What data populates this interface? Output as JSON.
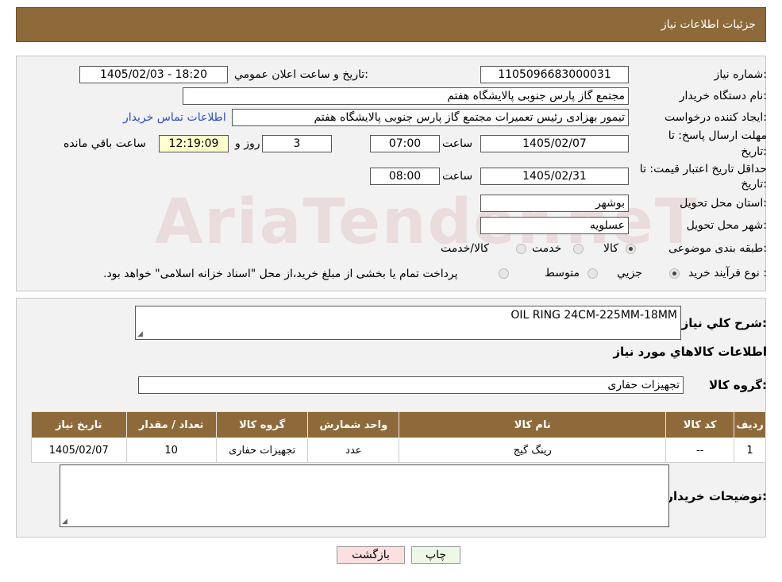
{
  "header": {
    "title": "جزئیات اطلاعات نیاز"
  },
  "watermark": "AriaTender.neT",
  "form": {
    "need_number_label": "شماره نیاز:",
    "need_number": "1105096683000031",
    "announce_label": "تاریخ و ساعت اعلان عمومي:",
    "announce_value": "1405/02/03 - 18:20",
    "buyer_org_label": "نام دستگاه خریدار:",
    "buyer_org": "مجتمع گاز پارس جنوبی  پالایشگاه هفتم",
    "requester_label": "ایجاد کننده درخواست:",
    "requester": "تیمور بهزادی رئیس تعمیرات مجتمع گاز پارس جنوبی  پالایشگاه هفتم",
    "contact_link": "اطلاعات تماس خریدار",
    "deadline_label_1": "مهلت ارسال پاسخ: تا",
    "deadline_label_2": "تاریخ:",
    "deadline_date": "1405/02/07",
    "time_label": "ساعت",
    "deadline_time": "07:00",
    "days": "3",
    "days_label": "روز و",
    "remaining_time": "12:19:09",
    "remaining_label": "ساعت باقي مانده",
    "validity_label_1": "حداقل تاریخ اعتبار قیمت: تا",
    "validity_label_2": "تاریخ:",
    "validity_date": "1405/02/31",
    "validity_time": "08:00",
    "province_label": "استان محل تحویل:",
    "province": "بوشهر",
    "city_label": "شهر محل تحویل:",
    "city": "عسلویه",
    "category_label": "طبقه بندی موضوعی:",
    "category_options": [
      "کالا",
      "خدمت",
      "کالا/خدمت"
    ],
    "process_label": "نوع فرآیند خرید :",
    "process_options": [
      "جزیي",
      "متوسط"
    ],
    "process_note": "پرداخت تمام یا بخشی از مبلغ خرید،از محل \"اسناد خزانه اسلامی\" خواهد بود."
  },
  "details": {
    "summary_label": "شرح کلي نیاز:",
    "summary": "OIL RING 24CM-225MM-18MM",
    "goods_info_title": "اطلاعات کالاهاي مورد نیاز",
    "goods_group_label": "گروه کالا:",
    "goods_group": "تجهیزات حفاری",
    "table": {
      "headers": [
        "ردیف",
        "کد کالا",
        "نام کالا",
        "واحد شمارش",
        "گروه کالا",
        "تعداد / مقدار",
        "تاریخ نیاز"
      ],
      "rows": [
        [
          "1",
          "--",
          "رینگ گیج",
          "عدد",
          "تجهیزات حفاری",
          "10",
          "1405/02/07"
        ]
      ]
    },
    "buyer_notes_label": "توضیحات خریدار:"
  },
  "buttons": {
    "print": "چاپ",
    "back": "بازگشت"
  },
  "colors": {
    "header_bg": "#8e6a3b",
    "panel_bg": "#f2f2f2",
    "link": "#2a4dcc",
    "remaining_bg": "#ffffcc",
    "back_btn_bg": "#fbe0e0",
    "print_btn_bg": "#eef8e6"
  }
}
